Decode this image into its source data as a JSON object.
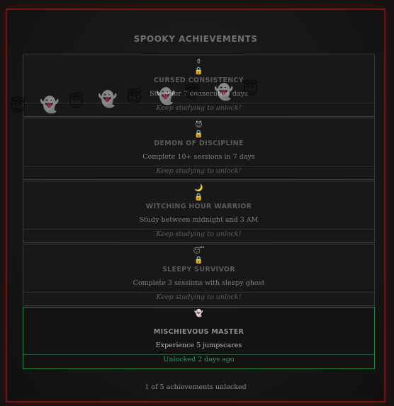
{
  "title": "Spooky Achievements",
  "floating_emojis": [
    "😇",
    "👻",
    "😇",
    "👻",
    "😇",
    "👻",
    "😇",
    "👻",
    "😇"
  ],
  "achievements": [
    {
      "icon": "⚱",
      "lock": "🔒",
      "name": "Cursed Consistency",
      "desc": "Study for 7 consecutive days",
      "status": "Keep studying to unlock!",
      "unlocked": false
    },
    {
      "icon": "😈",
      "lock": "🔒",
      "name": "Demon of Discipline",
      "desc": "Complete 10+ sessions in 7 days",
      "status": "Keep studying to unlock!",
      "unlocked": false
    },
    {
      "icon": "🌙",
      "lock": "🔒",
      "name": "Witching Hour Warrior",
      "desc": "Study between midnight and 3 AM",
      "status": "Keep studying to unlock!",
      "unlocked": false
    },
    {
      "icon": "😴",
      "lock": "🔒",
      "name": "Sleepy Survivor",
      "desc": "Complete 3 sessions with sleepy ghost",
      "status": "Keep studying to unlock!",
      "unlocked": false
    },
    {
      "icon": "👻",
      "lock": "",
      "name": "Mischievous Master",
      "desc": "Experience 5 jumpscares",
      "status": "Unlocked 2 days ago",
      "unlocked": true
    }
  ],
  "summary": {
    "count": "1",
    "text": " of 5 achievements unlocked"
  },
  "colors": {
    "border": "#7a1515",
    "unlocked_border": "#1f8a4a",
    "unlocked_text": "#1fa155"
  }
}
